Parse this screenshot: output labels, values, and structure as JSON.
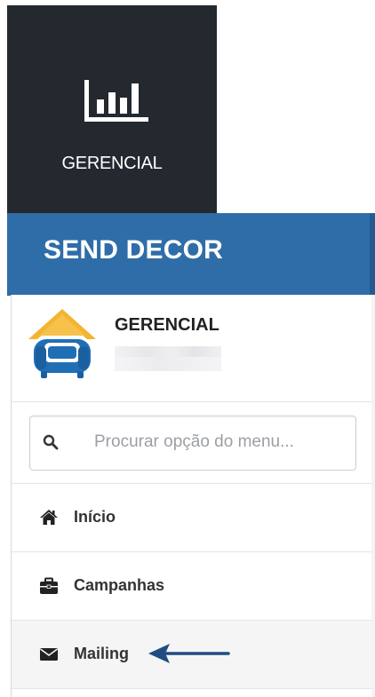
{
  "tile": {
    "label": "GERENCIAL",
    "icon": "bar-chart-icon",
    "background": "#23292f"
  },
  "header": {
    "title": "SEND DECOR",
    "color": "#2f6da8"
  },
  "profile": {
    "name": "GERENCIAL",
    "avatar_icon": "sofa-house-logo-icon"
  },
  "search": {
    "placeholder": "Procurar opção do menu...",
    "icon": "search-icon"
  },
  "menu": {
    "items": [
      {
        "label": "Início",
        "icon": "home-icon"
      },
      {
        "label": "Campanhas",
        "icon": "briefcase-icon"
      },
      {
        "label": "Mailing",
        "icon": "envelope-icon",
        "highlighted": true
      }
    ]
  },
  "annotation": {
    "icon": "arrow-left-icon",
    "color": "#1f4d82"
  }
}
